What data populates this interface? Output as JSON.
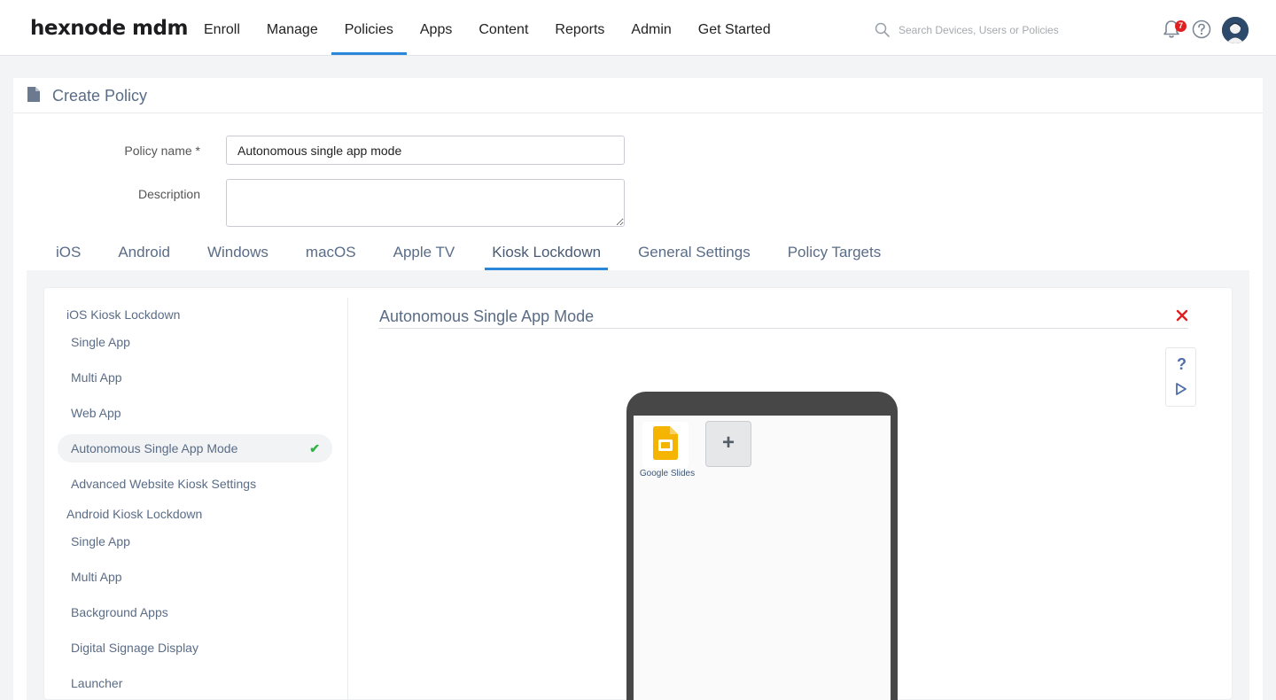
{
  "brand": {
    "logo_text": "hexnode mdm"
  },
  "nav": {
    "items": [
      {
        "label": "Enroll"
      },
      {
        "label": "Manage"
      },
      {
        "label": "Policies",
        "active": true
      },
      {
        "label": "Apps"
      },
      {
        "label": "Content"
      },
      {
        "label": "Reports"
      },
      {
        "label": "Admin"
      },
      {
        "label": "Get Started"
      }
    ]
  },
  "search": {
    "placeholder": "Search Devices, Users or Policies"
  },
  "notifications": {
    "count": "7",
    "icon": "bell-icon"
  },
  "page": {
    "title": "Create Policy"
  },
  "form": {
    "policy_name_label": "Policy name *",
    "policy_name_value": "Autonomous single app mode",
    "description_label": "Description",
    "description_value": ""
  },
  "tabs": [
    {
      "label": "iOS"
    },
    {
      "label": "Android"
    },
    {
      "label": "Windows"
    },
    {
      "label": "macOS"
    },
    {
      "label": "Apple TV"
    },
    {
      "label": "Kiosk Lockdown",
      "active": true
    },
    {
      "label": "General Settings"
    },
    {
      "label": "Policy Targets"
    }
  ],
  "sidebar": {
    "ios_group": "iOS Kiosk Lockdown",
    "ios_items": [
      {
        "label": "Single App"
      },
      {
        "label": "Multi App"
      },
      {
        "label": "Web App"
      },
      {
        "label": "Autonomous Single App Mode",
        "active": true,
        "configured": true
      },
      {
        "label": "Advanced Website Kiosk Settings"
      }
    ],
    "android_group": "Android Kiosk Lockdown",
    "android_items": [
      {
        "label": "Single App"
      },
      {
        "label": "Multi App"
      },
      {
        "label": "Background Apps"
      },
      {
        "label": "Digital Signage Display"
      },
      {
        "label": "Launcher"
      }
    ]
  },
  "section": {
    "title": "Autonomous Single App Mode",
    "help_symbol": "?",
    "check_symbol": "✔"
  },
  "preview": {
    "apps": [
      {
        "name": "Google Slides",
        "icon": "google-slides-icon"
      }
    ],
    "add_symbol": "+"
  },
  "colors": {
    "accent": "#2a86d8",
    "text_muted": "#5a6c86",
    "close": "#e02020",
    "check": "#2fb344",
    "phone": "#474747",
    "slides": "#f4b400"
  }
}
